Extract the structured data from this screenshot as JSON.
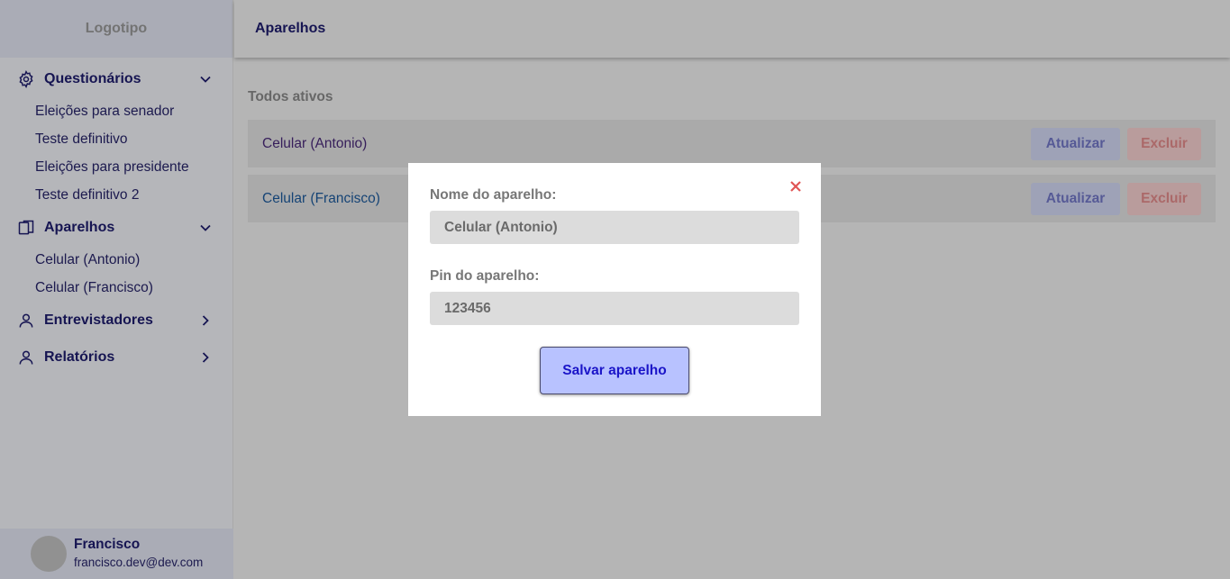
{
  "sidebar": {
    "logo": "Logotipo",
    "sections": [
      {
        "label": "Questionários",
        "icon": "gear-icon",
        "expanded": true,
        "items": [
          "Eleições para senador",
          "Teste definitivo",
          "Eleições para presidente",
          "Teste definitivo 2"
        ]
      },
      {
        "label": "Aparelhos",
        "icon": "device-icon",
        "expanded": true,
        "items": [
          "Celular (Antonio)",
          "Celular (Francisco)"
        ]
      },
      {
        "label": "Entrevistadores",
        "icon": "user-icon",
        "expanded": false,
        "items": []
      },
      {
        "label": "Relatórios",
        "icon": "user-icon",
        "expanded": false,
        "items": []
      }
    ],
    "user": {
      "name": "Francisco",
      "email": "francisco.dev@dev.com"
    }
  },
  "header": {
    "title": "Aparelhos"
  },
  "main": {
    "section_title": "Todos ativos",
    "devices": [
      {
        "name": "Celular (Antonio)",
        "update_label": "Atualizar",
        "delete_label": "Excluir"
      },
      {
        "name": "Celular (Francisco)",
        "update_label": "Atualizar",
        "delete_label": "Excluir"
      }
    ]
  },
  "modal": {
    "name_label": "Nome do aparelho:",
    "name_value": "Celular (Antonio)",
    "pin_label": "Pin do aparelho:",
    "pin_value": "123456",
    "save_label": "Salvar aparelho"
  },
  "colors": {
    "nav_text": "#1e1c6e",
    "device_name_1": "#4a2a7a",
    "device_name_2": "#1c5a9c",
    "close_icon": "#e05555",
    "save_button": "#b8c2ff"
  }
}
